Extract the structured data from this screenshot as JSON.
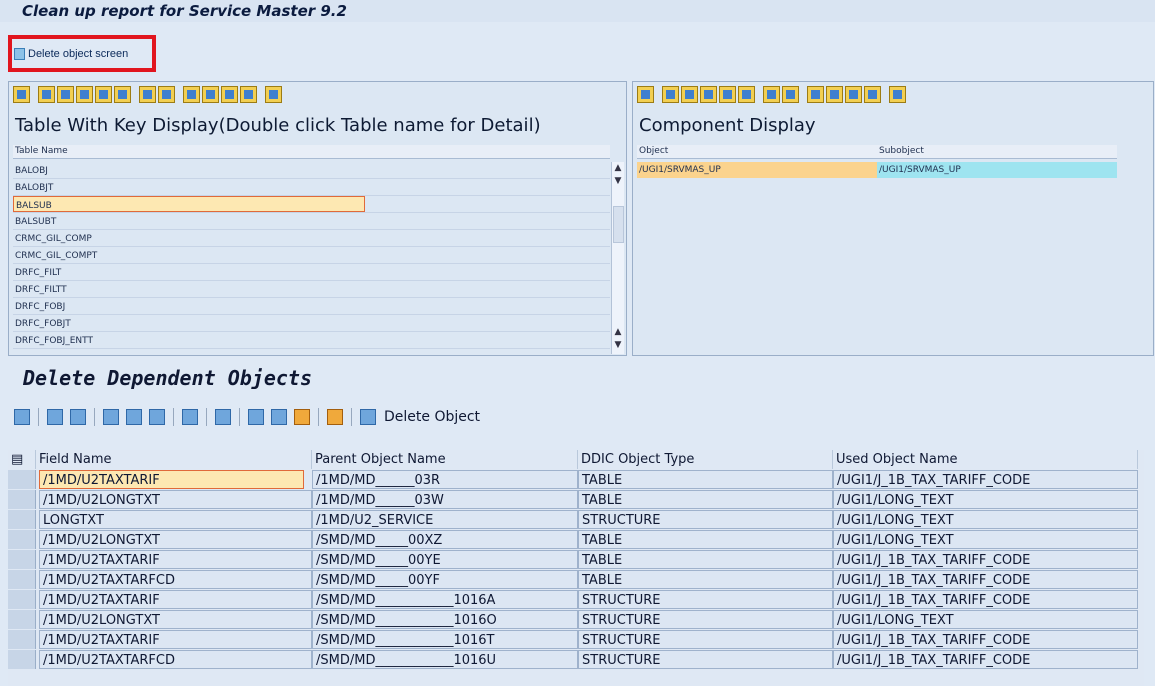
{
  "title": "Clean up report for Service Master 9.2",
  "appbar": {
    "delete_screen_label": "Delete object screen"
  },
  "left_pane": {
    "title": "Table With Key Display(Double click Table name for Detail)",
    "header": "Table Name",
    "rows": [
      "BALOBJ",
      "BALOBJT",
      "BALSUB",
      "BALSUBT",
      "CRMC_GIL_COMP",
      "CRMC_GIL_COMPT",
      "DRFC_FILT",
      "DRFC_FILTT",
      "DRFC_FOBJ",
      "DRFC_FOBJT",
      "DRFC_FOBJ_ENTT"
    ]
  },
  "right_pane": {
    "title": "Component Display",
    "headers": [
      "Object",
      "Subobject"
    ],
    "row": [
      "/UGI1/SRVMAS_UP",
      "/UGI1/SRVMAS_UP"
    ]
  },
  "section": {
    "title": "Delete Dependent Objects",
    "delete_label": "Delete Object"
  },
  "table": {
    "headers": [
      "Field Name",
      "Parent Object Name",
      "DDIC Object Type",
      "Used Object Name"
    ],
    "rows": [
      [
        "/1MD/U2TAXTARIF",
        "/1MD/MD______03R",
        "TABLE",
        "/UGI1/J_1B_TAX_TARIFF_CODE"
      ],
      [
        "/1MD/U2LONGTXT",
        "/1MD/MD______03W",
        "TABLE",
        "/UGI1/LONG_TEXT"
      ],
      [
        "LONGTXT",
        "/1MD/U2_SERVICE",
        "STRUCTURE",
        "/UGI1/LONG_TEXT"
      ],
      [
        "/1MD/U2LONGTXT",
        "/SMD/MD_____00XZ",
        "TABLE",
        "/UGI1/LONG_TEXT"
      ],
      [
        "/1MD/U2TAXTARIF",
        "/SMD/MD_____00YE",
        "TABLE",
        "/UGI1/J_1B_TAX_TARIFF_CODE"
      ],
      [
        "/1MD/U2TAXTARFCD",
        "/SMD/MD_____00YF",
        "TABLE",
        "/UGI1/J_1B_TAX_TARIFF_CODE"
      ],
      [
        "/1MD/U2TAXTARIF",
        "/SMD/MD____________1016A",
        "STRUCTURE",
        "/UGI1/J_1B_TAX_TARIFF_CODE"
      ],
      [
        "/1MD/U2LONGTXT",
        "/SMD/MD____________1016O",
        "STRUCTURE",
        "/UGI1/LONG_TEXT"
      ],
      [
        "/1MD/U2TAXTARIF",
        "/SMD/MD____________1016T",
        "STRUCTURE",
        "/UGI1/J_1B_TAX_TARIFF_CODE"
      ],
      [
        "/1MD/U2TAXTARFCD",
        "/SMD/MD____________1016U",
        "STRUCTURE",
        "/UGI1/J_1B_TAX_TARIFF_CODE"
      ]
    ]
  }
}
